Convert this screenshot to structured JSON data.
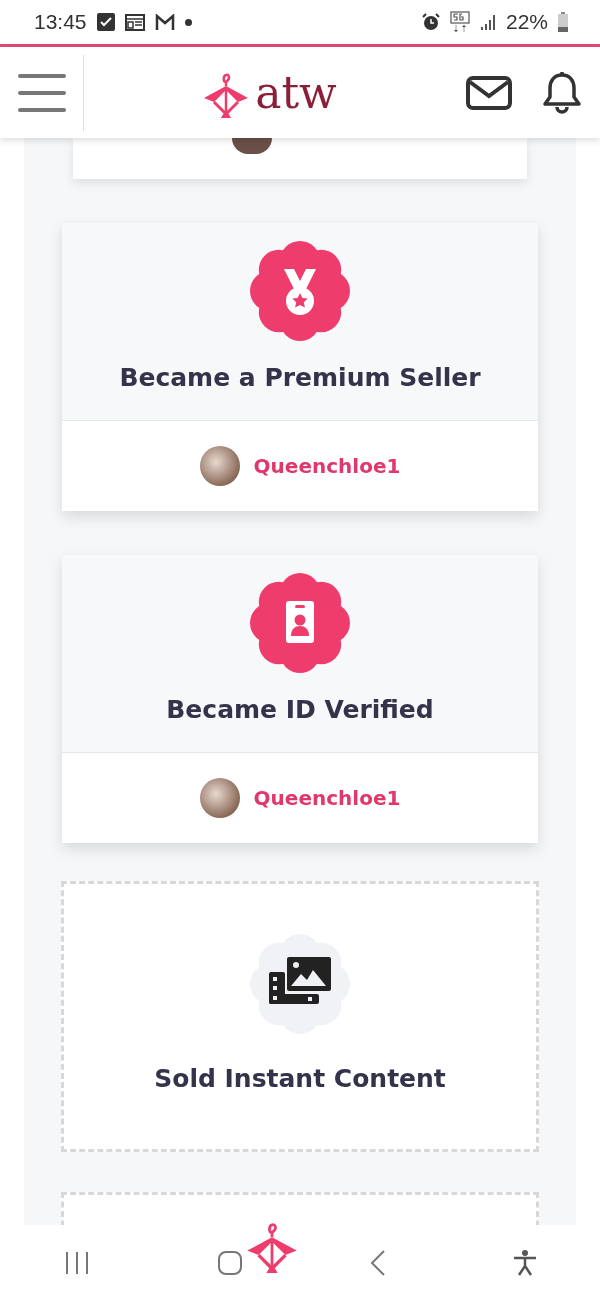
{
  "status_bar": {
    "time": "13:45",
    "battery": "22%"
  },
  "header": {
    "logo": "atw"
  },
  "achievements": [
    {
      "kind": "earned",
      "title": "Became a Premium Seller",
      "user": "Queenchloe1"
    },
    {
      "kind": "earned",
      "title": "Became ID Verified",
      "user": "Queenchloe1"
    },
    {
      "kind": "locked",
      "title": "Sold Instant Content"
    }
  ]
}
